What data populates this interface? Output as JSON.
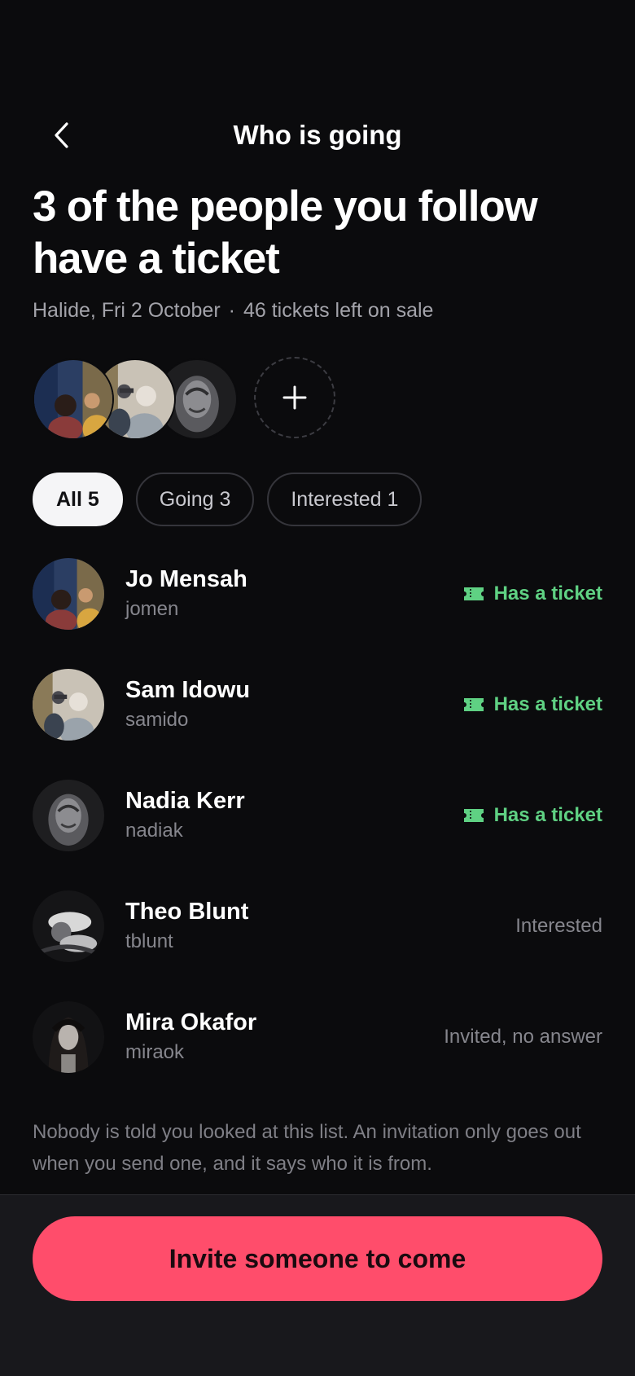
{
  "header": {
    "title": "Who is going",
    "back_icon": "chevron-left-icon"
  },
  "headline": "3 of the people you follow have a ticket",
  "event": {
    "venue_date": "Halide, Fri 2 October",
    "separator": "·",
    "tickets_left": "46 tickets left on sale"
  },
  "filters": [
    {
      "label": "All 5",
      "active": true
    },
    {
      "label": "Going 3",
      "active": false
    },
    {
      "label": "Interested 1",
      "active": false
    }
  ],
  "people": [
    {
      "name": "Jo Mensah",
      "handle": "jomen",
      "status": "Has a ticket",
      "status_type": "ticket"
    },
    {
      "name": "Sam Idowu",
      "handle": "samido",
      "status": "Has a ticket",
      "status_type": "ticket"
    },
    {
      "name": "Nadia Kerr",
      "handle": "nadiak",
      "status": "Has a ticket",
      "status_type": "ticket"
    },
    {
      "name": "Theo Blunt",
      "handle": "tblunt",
      "status": "Interested",
      "status_type": "muted"
    },
    {
      "name": "Mira Okafor",
      "handle": "miraok",
      "status": "Invited, no answer",
      "status_type": "muted"
    }
  ],
  "privacy_note": "Nobody is told you looked at this list. An invitation only goes out when you send one, and it says who it is from.",
  "cta_label": "Invite someone to come",
  "colors": {
    "background": "#0b0b0d",
    "accent": "#ff4d6b",
    "ticket_green": "#5fd183",
    "muted_text": "#86868d"
  }
}
